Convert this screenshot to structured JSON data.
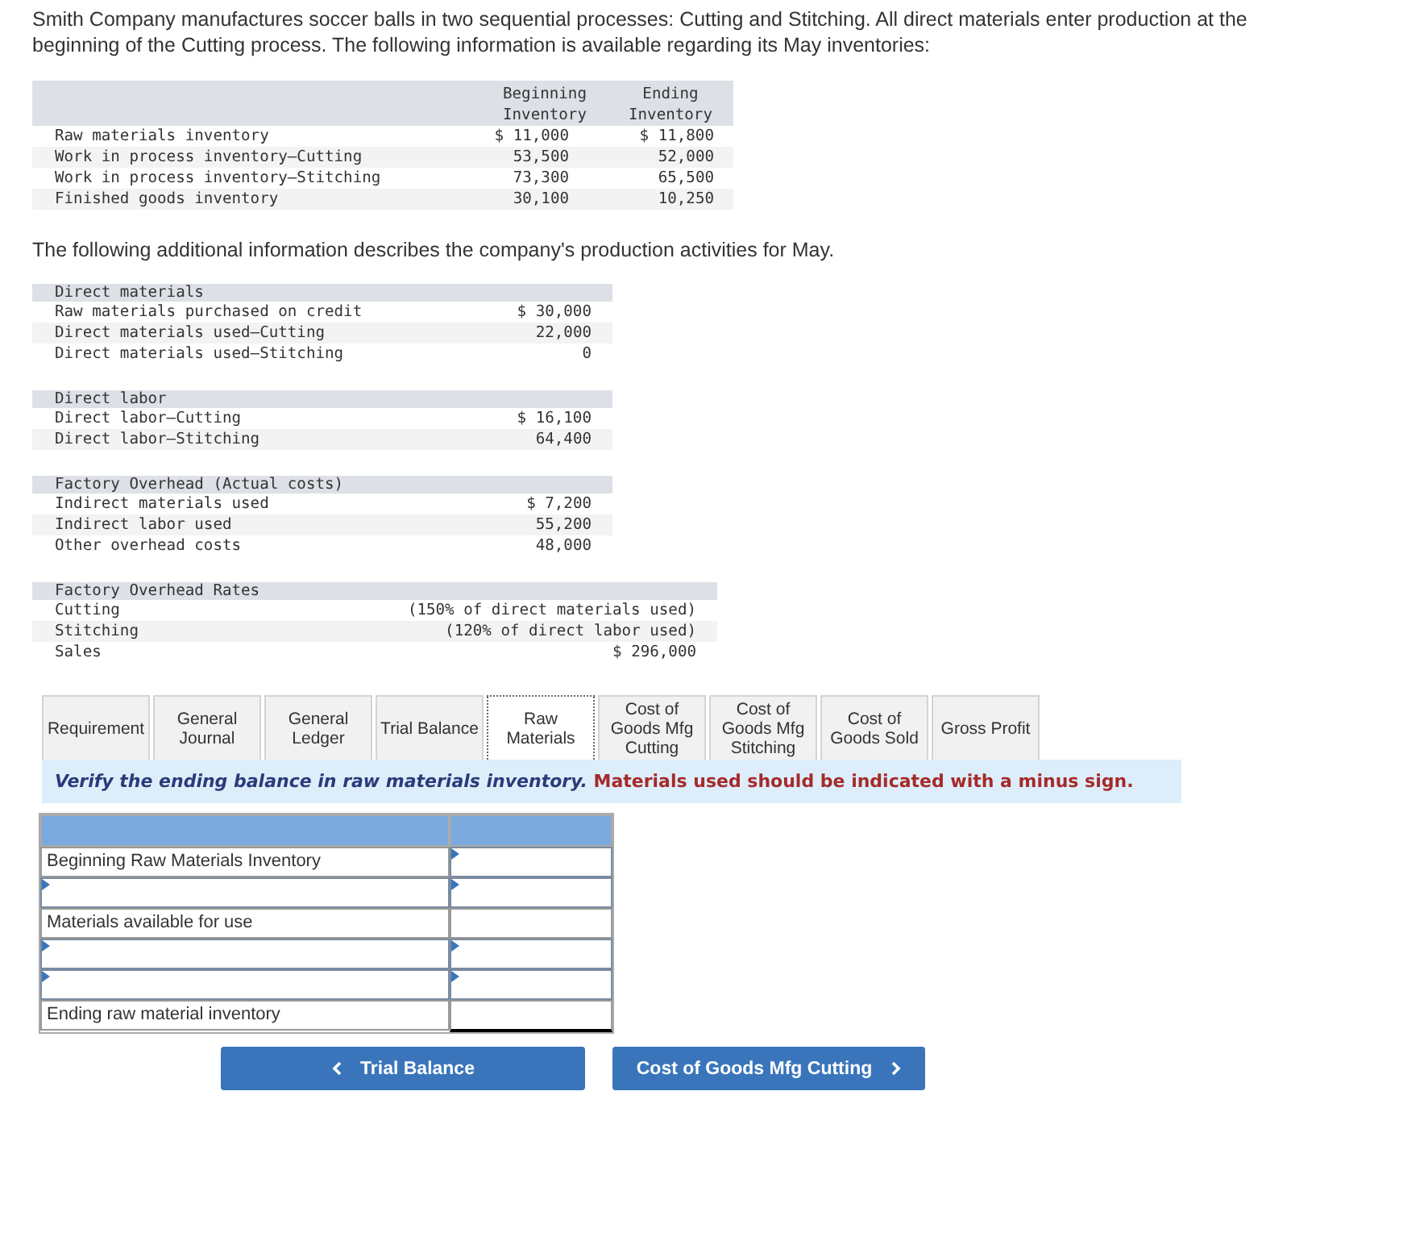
{
  "intro": "Smith Company manufactures soccer balls in two sequential processes: Cutting and Stitching. All direct materials enter production at the beginning of the Cutting process. The following information is available regarding its May inventories:",
  "inventory_table": {
    "columns": [
      "Beginning Inventory",
      "Ending Inventory"
    ],
    "rows": [
      {
        "label": "Raw materials inventory",
        "values": [
          "$ 11,000",
          "$ 11,800"
        ]
      },
      {
        "label": "Work in process inventory—Cutting",
        "values": [
          "53,500",
          "52,000"
        ]
      },
      {
        "label": "Work in process inventory—Stitching",
        "values": [
          "73,300",
          "65,500"
        ]
      },
      {
        "label": "Finished goods inventory",
        "values": [
          "30,100",
          "10,250"
        ]
      }
    ]
  },
  "additional_intro": "The following additional information describes the company's production activities for May.",
  "sections": [
    {
      "title": "Direct materials",
      "wide": false,
      "rows": [
        {
          "label": "Raw materials purchased on credit",
          "value": "$ 30,000"
        },
        {
          "label": "Direct materials used—Cutting",
          "value": "22,000"
        },
        {
          "label": "Direct materials used—Stitching",
          "value": "0"
        }
      ]
    },
    {
      "title": "Direct labor",
      "wide": false,
      "rows": [
        {
          "label": "Direct labor—Cutting",
          "value": "$ 16,100"
        },
        {
          "label": "Direct labor—Stitching",
          "value": "64,400"
        }
      ]
    },
    {
      "title": "Factory Overhead (Actual costs)",
      "wide": false,
      "rows": [
        {
          "label": "Indirect materials used",
          "value": "$ 7,200"
        },
        {
          "label": "Indirect labor used",
          "value": "55,200"
        },
        {
          "label": "Other overhead costs",
          "value": "48,000"
        }
      ]
    },
    {
      "title": "Factory Overhead Rates",
      "wide": true,
      "rows": [
        {
          "label": "Cutting",
          "value": "(150% of direct materials used)"
        },
        {
          "label": "Stitching",
          "value": "(120% of direct labor used)"
        },
        {
          "label": "Sales",
          "value": "$ 296,000"
        }
      ]
    }
  ],
  "tabs": [
    {
      "label": "Requirement",
      "selected": false
    },
    {
      "label": "General Journal",
      "selected": false
    },
    {
      "label": "General Ledger",
      "selected": false
    },
    {
      "label": "Trial Balance",
      "selected": false
    },
    {
      "label": "Raw Materials",
      "selected": true
    },
    {
      "label": "Cost of Goods Mfg Cutting",
      "selected": false
    },
    {
      "label": "Cost of Goods Mfg Stitching",
      "selected": false
    },
    {
      "label": "Cost of Goods Sold",
      "selected": false
    },
    {
      "label": "Gross Profit",
      "selected": false
    }
  ],
  "instruction": {
    "main": "Verify the ending balance in raw materials inventory.",
    "note": "Materials used should be indicated with a minus sign."
  },
  "worksheet": {
    "rows": [
      {
        "kind": "given",
        "label": "Beginning Raw Materials Inventory"
      },
      {
        "kind": "entry"
      },
      {
        "kind": "subtotal",
        "label": "Materials available for use"
      },
      {
        "kind": "entry"
      },
      {
        "kind": "entry"
      },
      {
        "kind": "total",
        "label": "Ending raw material inventory"
      }
    ]
  },
  "nav": {
    "back": "Trial Balance",
    "next": "Cost of Goods Mfg Cutting"
  }
}
